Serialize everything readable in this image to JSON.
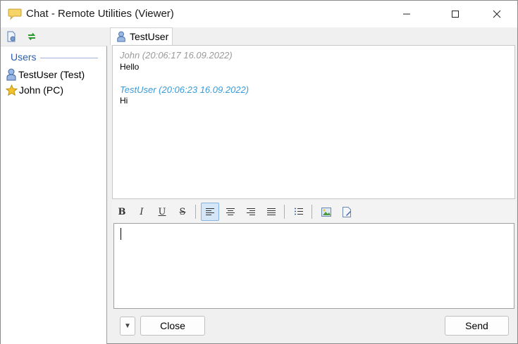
{
  "window": {
    "title": "Chat - Remote Utilities (Viewer)",
    "icons": {
      "app": "chat-bubble-icon",
      "minimize": "minimize-icon",
      "maximize": "maximize-icon",
      "close": "close-icon"
    }
  },
  "left_toolbar": {
    "icons": [
      "document-settings-icon",
      "refresh-icon"
    ]
  },
  "users": {
    "header": "Users",
    "items": [
      {
        "label": "TestUser (Test)",
        "icon": "user-icon"
      },
      {
        "label": "John (PC)",
        "icon": "star-icon"
      }
    ]
  },
  "tab": {
    "label": "TestUser",
    "icon": "user-icon"
  },
  "messages": [
    {
      "header": "John (20:06:17 16.09.2022)",
      "text": "Hello",
      "color": "#9a9a9a"
    },
    {
      "header": "TestUser (20:06:23 16.09.2022)",
      "text": "Hi",
      "color": "#3a9bd8"
    }
  ],
  "format_toolbar": {
    "bold": "B",
    "italic": "I",
    "underline": "U",
    "strike": "S",
    "icons": [
      "align-left-icon",
      "align-center-icon",
      "align-right-icon",
      "align-justify-icon",
      "bullet-list-icon",
      "insert-image-icon",
      "insert-file-icon"
    ],
    "active": "align-left"
  },
  "editor": {
    "value": ""
  },
  "buttons": {
    "dropdown": "▼",
    "close": "Close",
    "send": "Send"
  }
}
